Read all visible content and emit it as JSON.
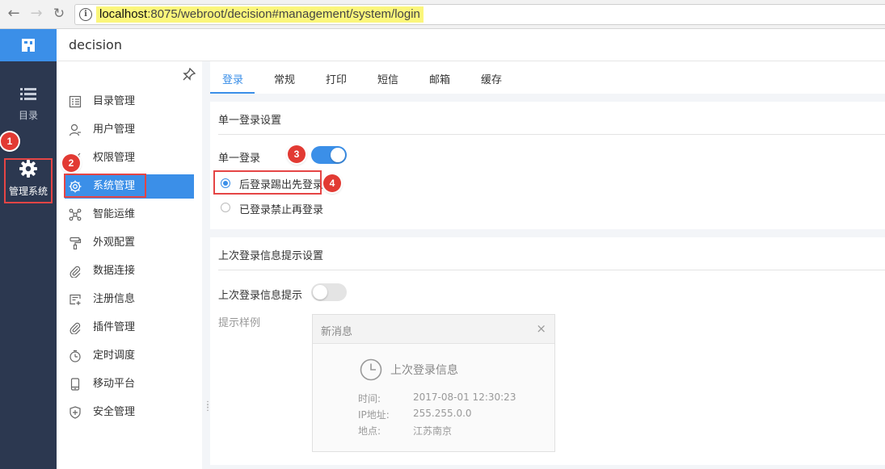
{
  "browser": {
    "url_host": "localhost",
    "url_rest": ":8075/webroot/decision#management/system/login"
  },
  "rail": {
    "catalog_label": "目录",
    "manage_label": "管理系统"
  },
  "header": {
    "title": "decision"
  },
  "sidebar": {
    "items": [
      {
        "label": "目录管理",
        "icon": "list-icon"
      },
      {
        "label": "用户管理",
        "icon": "user-icon"
      },
      {
        "label": "权限管理",
        "icon": "key-icon"
      },
      {
        "label": "系统管理",
        "icon": "gear-icon",
        "active": true
      },
      {
        "label": "智能运维",
        "icon": "network-icon"
      },
      {
        "label": "外观配置",
        "icon": "paint-roller-icon"
      },
      {
        "label": "数据连接",
        "icon": "paperclip-icon"
      },
      {
        "label": "注册信息",
        "icon": "register-icon"
      },
      {
        "label": "插件管理",
        "icon": "plugin-icon"
      },
      {
        "label": "定时调度",
        "icon": "timer-icon"
      },
      {
        "label": "移动平台",
        "icon": "mobile-icon"
      },
      {
        "label": "安全管理",
        "icon": "shield-icon"
      }
    ]
  },
  "tabs": [
    "登录",
    "常规",
    "打印",
    "短信",
    "邮箱",
    "缓存"
  ],
  "sso": {
    "section_title": "单一登录设置",
    "toggle_label": "单一登录",
    "toggle_on": true,
    "option_kick": "后登录踢出先登录",
    "option_block": "已登录禁止再登录"
  },
  "last_login": {
    "section_title": "上次登录信息提示设置",
    "toggle_label": "上次登录信息提示",
    "toggle_on": false,
    "sample_label": "提示样例",
    "sample": {
      "header": "新消息",
      "close": "×",
      "title": "上次登录信息",
      "time_key": "时间:",
      "time_val": "2017-08-01 12:30:23",
      "ip_key": "IP地址:",
      "ip_val": "255.255.0.0",
      "place_key": "地点:",
      "place_val": "江苏南京"
    }
  },
  "annotations": [
    "1",
    "2",
    "3",
    "4"
  ],
  "colors": {
    "accent": "#3b8fe8",
    "rail": "#2c3850",
    "marker": "#e23a33"
  }
}
